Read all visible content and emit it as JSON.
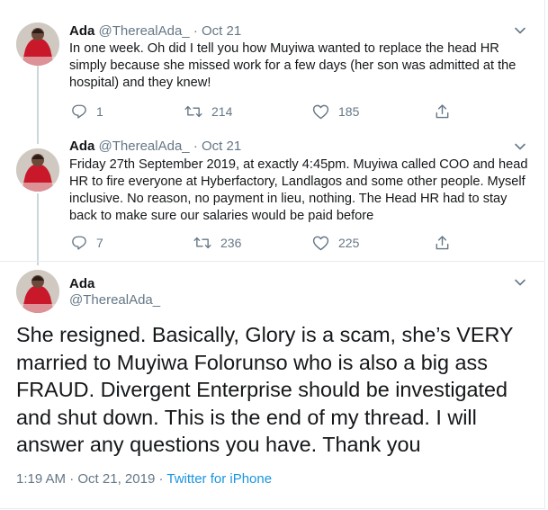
{
  "tweets": [
    {
      "name": "Ada",
      "handle": "@TherealAda_",
      "separator": "·",
      "date": "Oct 21",
      "text": "In one week. Oh did I tell you how Muyiwa wanted to replace the head HR simply because she missed work for a few days (her son was admitted at the hospital) and they knew!",
      "replies": "1",
      "retweets": "214",
      "likes": "185"
    },
    {
      "name": "Ada",
      "handle": "@TherealAda_",
      "separator": "·",
      "date": "Oct 21",
      "text": "Friday 27th September 2019, at exactly 4:45pm. Muyiwa called COO and head HR to fire everyone at Hyberfactory, Landlagos and some other people. Myself inclusive. No reason, no payment in lieu, nothing. The Head HR had to stay back to make sure our salaries would be paid before",
      "replies": "7",
      "retweets": "236",
      "likes": "225"
    }
  ],
  "main": {
    "name": "Ada",
    "handle": "@TherealAda_",
    "text": "She resigned. Basically, Glory is a scam, she’s VERY married to Muyiwa Folorunso who is also a big ass FRAUD. Divergent Enterprise should be investigated and shut down. This is the end of my thread. I will answer any questions you have. Thank you",
    "time": "1:19 AM",
    "meta_dot": " · ",
    "date": "Oct 21, 2019",
    "source": "Twitter for iPhone"
  },
  "colors": {
    "text": "#14171a",
    "secondary": "#657786",
    "link": "#1b95e0",
    "border": "#e6ecf0",
    "thread_line": "#ccd6dd"
  },
  "icons": [
    "reply-icon",
    "retweet-icon",
    "like-icon",
    "share-icon",
    "chevron-down-icon"
  ]
}
